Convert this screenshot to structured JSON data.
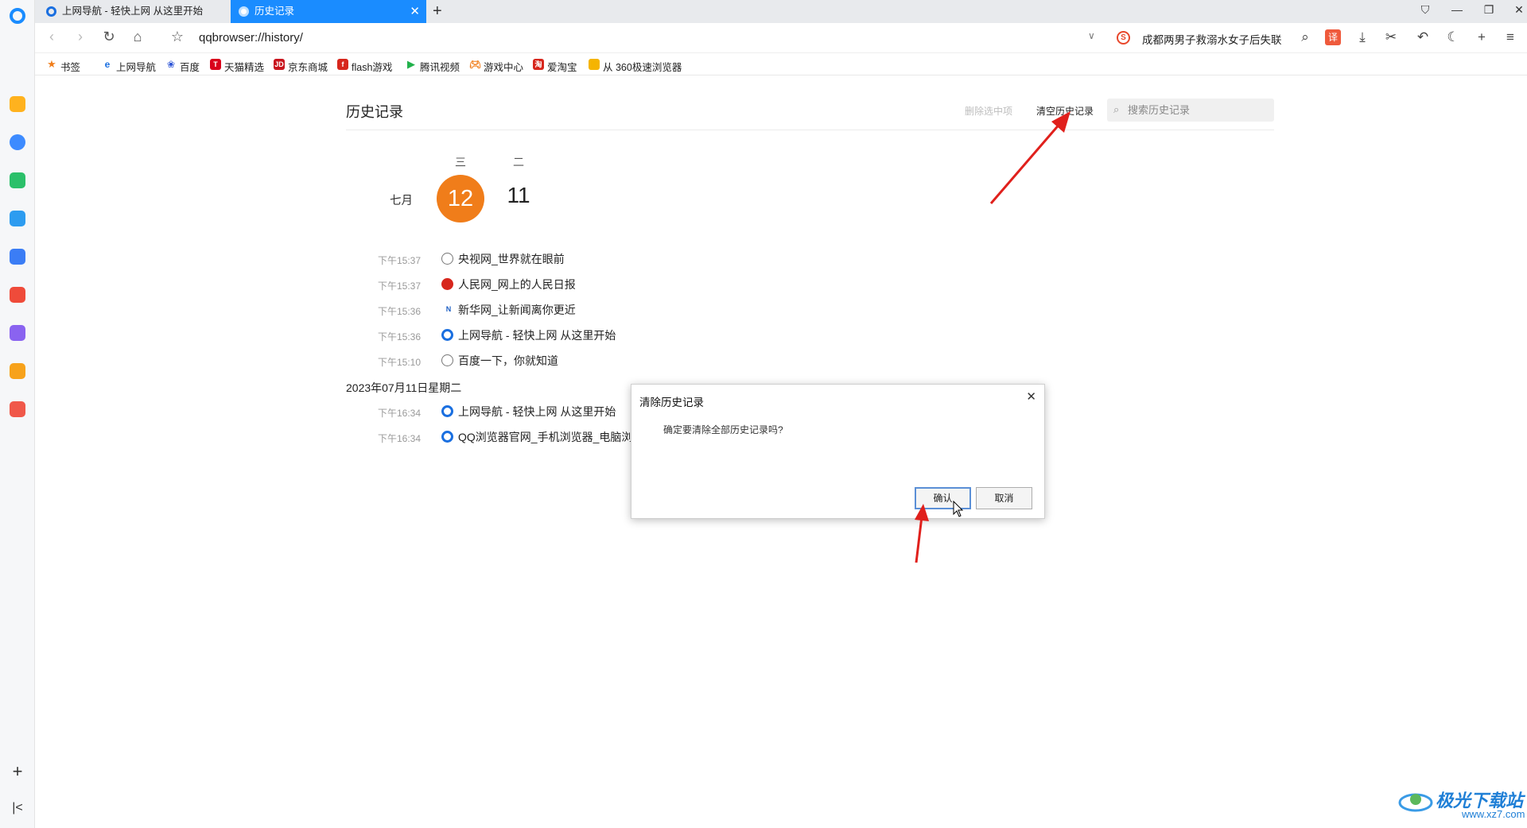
{
  "tabs": [
    {
      "title": "上网导航 - 轻快上网 从这里开始",
      "active": false
    },
    {
      "title": "历史记录",
      "active": true
    }
  ],
  "address": {
    "url": "qqbrowser://history/"
  },
  "news_ticker": "成都两男子救溺水女子后失联",
  "translate_label": "译",
  "sogou_label": "S",
  "bookmarks": [
    {
      "label": "书签",
      "icon": "star-icon",
      "color": "#f07d1a"
    },
    {
      "label": "上网导航",
      "icon": "ie-icon",
      "color": "#1a6fe0"
    },
    {
      "label": "百度",
      "icon": "baidu-paw-icon",
      "color": "#2b53d6"
    },
    {
      "label": "天猫精选",
      "icon": "tmall-icon",
      "color": "#d9001b"
    },
    {
      "label": "京东商城",
      "icon": "jd-icon",
      "color": "#c9151e"
    },
    {
      "label": "flash游戏",
      "icon": "flash-game-icon",
      "color": "#d7261c"
    },
    {
      "label": "腾讯视频",
      "icon": "tencent-video-icon",
      "color": "#21b14b"
    },
    {
      "label": "游戏中心",
      "icon": "gamepad-icon",
      "color": "#f07d1a"
    },
    {
      "label": "爱淘宝",
      "icon": "aitaobao-icon",
      "color": "#d7261c"
    },
    {
      "label": "从 360极速浏览器",
      "icon": "folder-icon",
      "color": "#f5b400"
    }
  ],
  "history_page": {
    "title": "历史记录",
    "delete_selected": "删除选中项",
    "clear_history": "清空历史记录",
    "search_placeholder": "搜索历史记录",
    "month": "七月",
    "days": [
      {
        "weekday": "三",
        "day": "12",
        "active": true
      },
      {
        "weekday": "二",
        "day": "11",
        "active": false
      }
    ],
    "today_entries": [
      {
        "time": "下午15:37",
        "title": "央视网_世界就在眼前",
        "icon": "globe-icon"
      },
      {
        "time": "下午15:37",
        "title": "人民网_网上的人民日报",
        "icon": "people-daily-icon"
      },
      {
        "time": "下午15:36",
        "title": "新华网_让新闻离你更近",
        "icon": "xinhua-news-icon"
      },
      {
        "time": "下午15:36",
        "title": "上网导航 - 轻快上网 从这里开始",
        "icon": "qq-browser-icon"
      },
      {
        "time": "下午15:10",
        "title": "百度一下，你就知道",
        "icon": "globe-icon"
      }
    ],
    "date_header": "2023年07月11日星期二",
    "earlier_entries": [
      {
        "time": "下午16:34",
        "title": "上网导航 - 轻快上网 从这里开始",
        "icon": "qq-browser-icon"
      },
      {
        "time": "下午16:34",
        "title": "QQ浏览器官网_手机浏览器_电脑浏览器",
        "icon": "qq-browser-icon"
      }
    ]
  },
  "dialog": {
    "title": "清除历史记录",
    "message": "确定要清除全部历史记录吗?",
    "confirm": "确认",
    "cancel": "取消"
  },
  "watermark": {
    "text": "极光下载站",
    "url": "www.xz7.com"
  },
  "colors": {
    "accent": "#1a8cff",
    "today": "#f07d1a",
    "arrow": "#e0201c"
  }
}
